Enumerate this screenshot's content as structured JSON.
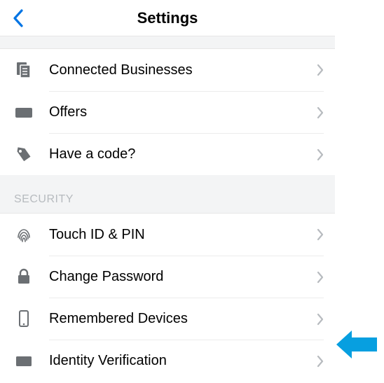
{
  "header": {
    "title": "Settings"
  },
  "sections": [
    {
      "header": null,
      "items": [
        {
          "label": "Connected Businesses"
        },
        {
          "label": "Offers"
        },
        {
          "label": "Have a code?"
        }
      ]
    },
    {
      "header": "SECURITY",
      "items": [
        {
          "label": "Touch ID & PIN"
        },
        {
          "label": "Change Password"
        },
        {
          "label": "Remembered Devices"
        },
        {
          "label": "Identity Verification"
        }
      ]
    }
  ]
}
